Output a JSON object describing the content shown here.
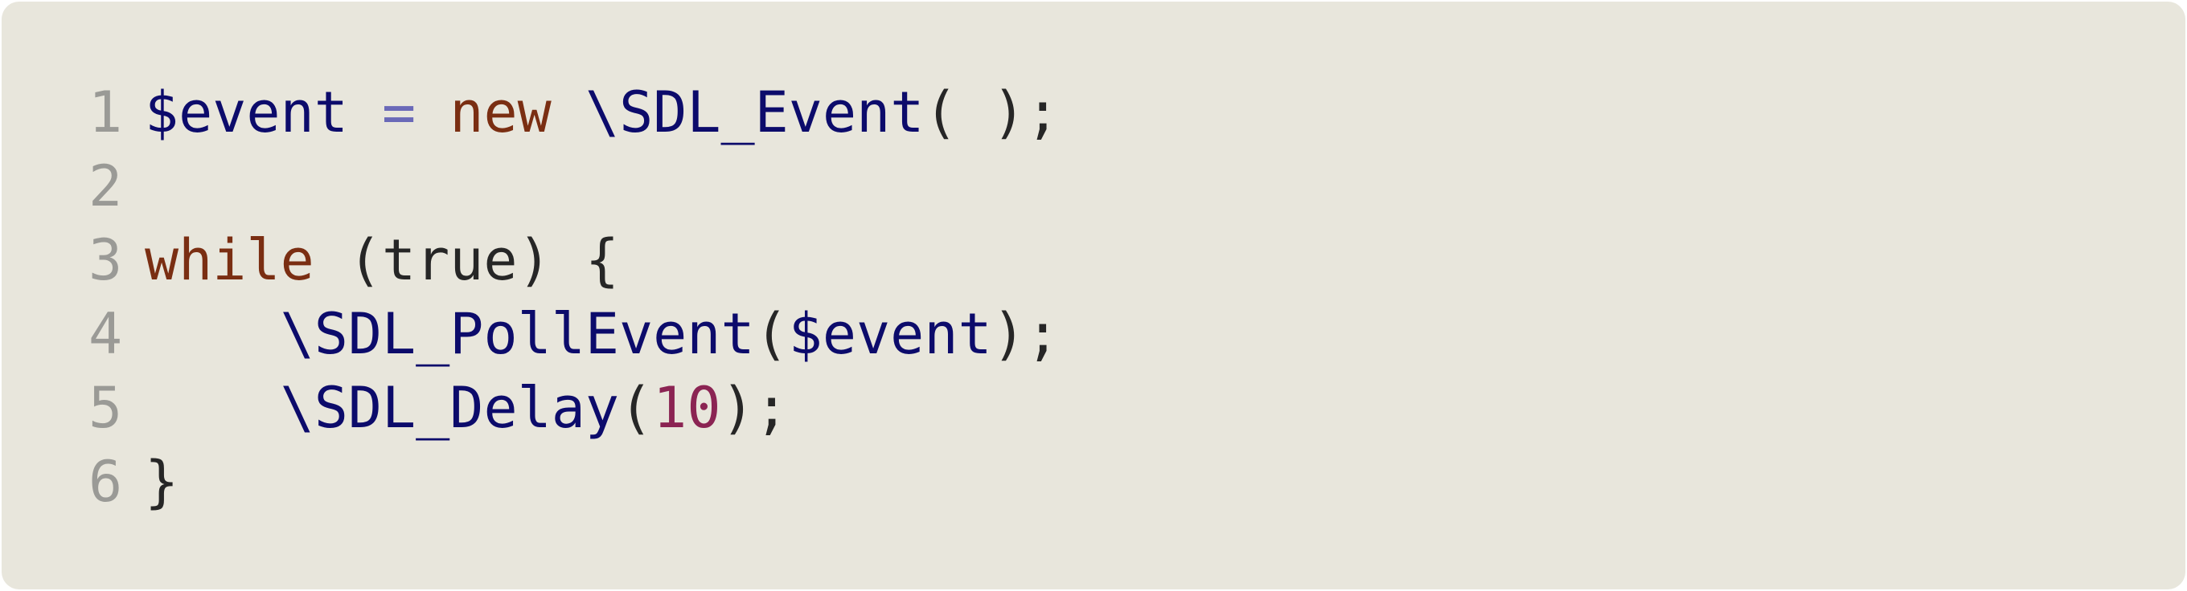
{
  "colors": {
    "background": "#e8e6dc",
    "line_number": "#9a9a96",
    "variable": "#0c0b6b",
    "operator": "#6a69b8",
    "keyword": "#7a2e12",
    "number": "#8b2453",
    "punctuation": "#262626"
  },
  "code": {
    "language": "php",
    "lines": [
      {
        "number": "1",
        "tokens": [
          {
            "type": "var",
            "text": "$event"
          },
          {
            "type": "plain",
            "text": " "
          },
          {
            "type": "op",
            "text": "="
          },
          {
            "type": "plain",
            "text": " "
          },
          {
            "type": "kw",
            "text": "new"
          },
          {
            "type": "plain",
            "text": " "
          },
          {
            "type": "cls",
            "text": "\\SDL_Event"
          },
          {
            "type": "punc",
            "text": "( );"
          }
        ]
      },
      {
        "number": "2",
        "tokens": []
      },
      {
        "number": "3",
        "tokens": [
          {
            "type": "kw",
            "text": "while"
          },
          {
            "type": "plain",
            "text": " (true) {"
          }
        ]
      },
      {
        "number": "4",
        "tokens": [
          {
            "type": "plain",
            "text": "    "
          },
          {
            "type": "fn",
            "text": "\\SDL_PollEvent"
          },
          {
            "type": "punc",
            "text": "("
          },
          {
            "type": "var",
            "text": "$event"
          },
          {
            "type": "punc",
            "text": ");"
          }
        ]
      },
      {
        "number": "5",
        "tokens": [
          {
            "type": "plain",
            "text": "    "
          },
          {
            "type": "fn",
            "text": "\\SDL_Delay"
          },
          {
            "type": "punc",
            "text": "("
          },
          {
            "type": "num",
            "text": "10"
          },
          {
            "type": "punc",
            "text": ");"
          }
        ]
      },
      {
        "number": "6",
        "tokens": [
          {
            "type": "punc",
            "text": "}"
          }
        ]
      }
    ]
  }
}
